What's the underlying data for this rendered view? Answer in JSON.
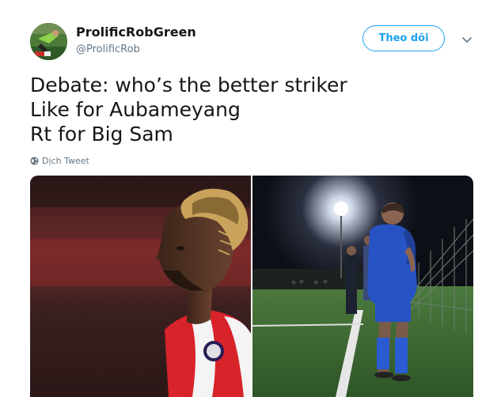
{
  "user": {
    "display_name": "ProlificRobGreen",
    "handle": "@ProlificRob"
  },
  "actions": {
    "follow_label": "Theo dõi",
    "menu_icon": "chevron-down-icon"
  },
  "tweet": {
    "lines": [
      "Debate: who’s the better striker",
      "Like for Aubameyang",
      "Rt for Big Sam"
    ],
    "translate_label": "Dịch Tweet",
    "translate_icon": "globe-icon"
  },
  "colors": {
    "accent": "#1da1f2",
    "text": "#14171a",
    "muted": "#657786",
    "arsenal_red": "#d8232a",
    "kit_blue": "#2753c4",
    "pitch_green": "#3f6b35"
  }
}
